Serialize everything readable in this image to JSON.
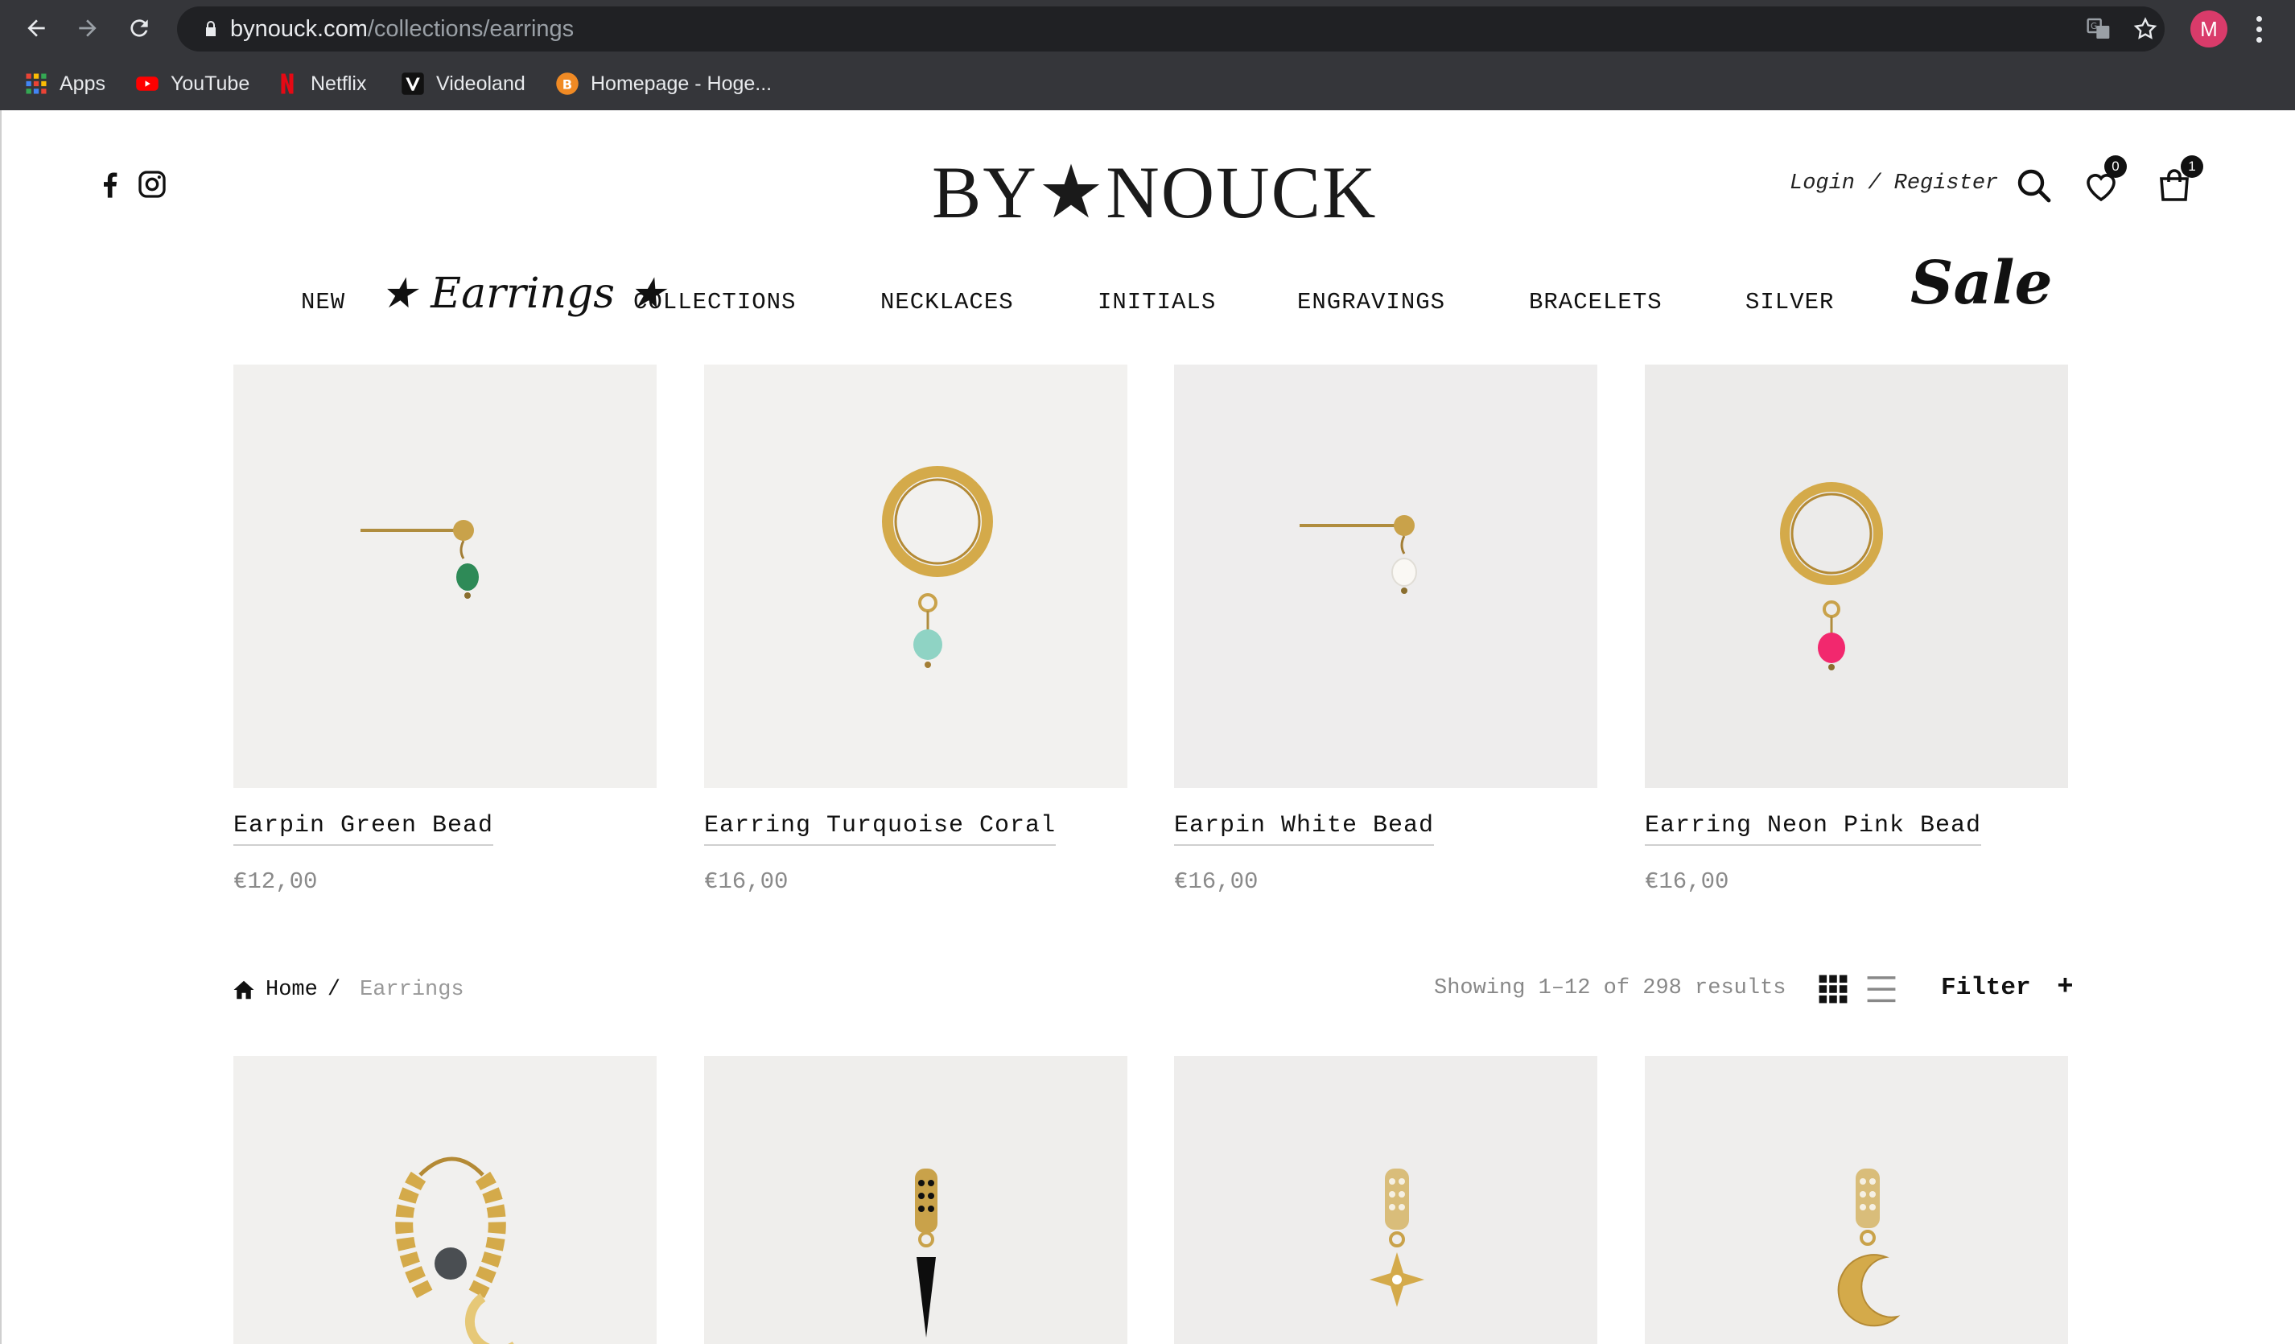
{
  "browser": {
    "url_domain": "bynouck.com",
    "url_path": "/collections/earrings",
    "profile_initial": "M",
    "bookmarks": [
      {
        "label": "Apps",
        "icon": "apps-grid-icon"
      },
      {
        "label": "YouTube",
        "icon": "youtube-icon"
      },
      {
        "label": "Netflix",
        "icon": "netflix-icon"
      },
      {
        "label": "Videoland",
        "icon": "videoland-icon"
      },
      {
        "label": "Homepage - Hoge...",
        "icon": "hogeschool-icon"
      }
    ]
  },
  "header": {
    "logo": "BY★NOUCK",
    "account_link": "Login / Register",
    "wishlist_count": "0",
    "cart_count": "1"
  },
  "menu": {
    "items": [
      "NEW",
      "COLLECTIONS",
      "NECKLACES",
      "INITIALS",
      "ENGRAVINGS",
      "BRACELETS",
      "SILVER"
    ],
    "earrings_label": "★ Earrings ★",
    "sale_label": "Sale"
  },
  "products_top": [
    {
      "name": "Earpin Green Bead",
      "price": "€12,00",
      "bead_color": "#2e8a57"
    },
    {
      "name": "Earring Turquoise Coral",
      "price": "€16,00",
      "bead_color": "#8fd3c4"
    },
    {
      "name": "Earpin White Bead",
      "price": "€16,00",
      "bead_color": "#f4f1ec"
    },
    {
      "name": "Earring Neon Pink Bead",
      "price": "€16,00",
      "bead_color": "#f2286e"
    }
  ],
  "breadcrumb": {
    "home": "Home",
    "separator": "/",
    "current": "Earrings"
  },
  "toolbar": {
    "results": "Showing 1–12 of 298 results",
    "filter_label": "Filter"
  },
  "colors": {
    "chrome": "#35363a",
    "urlbar": "#202124",
    "text": "#111111",
    "muted": "#888888",
    "gold": "#c9a24a"
  }
}
